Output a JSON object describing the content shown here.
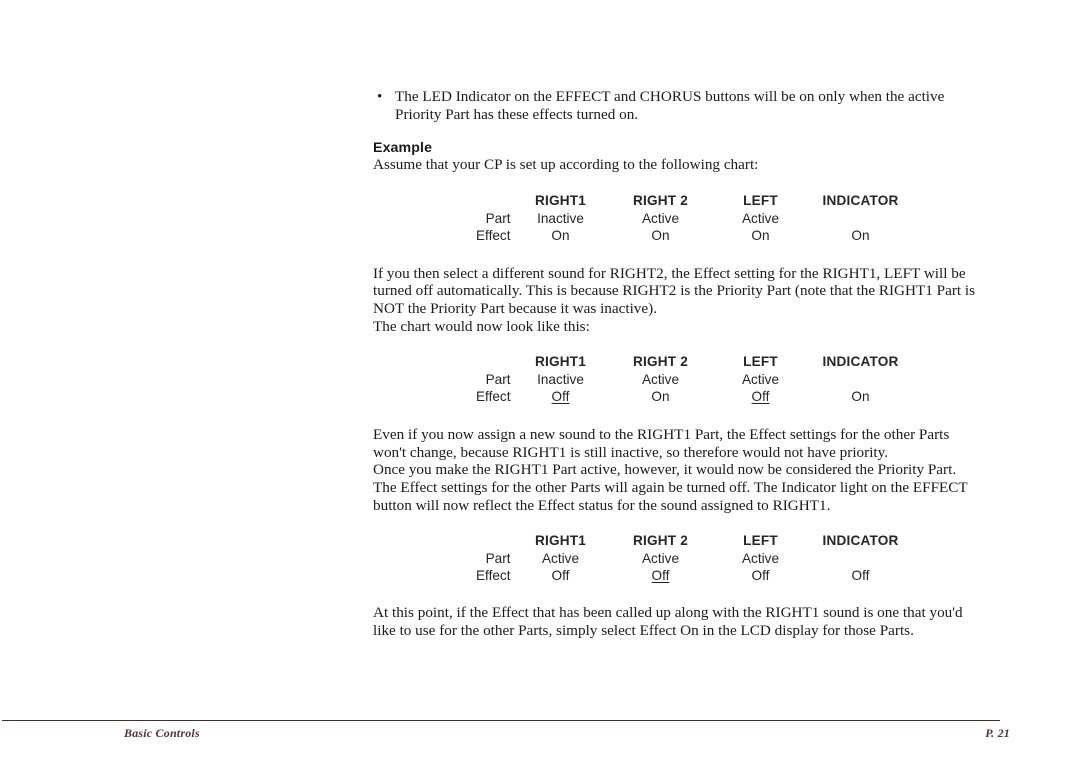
{
  "page": {
    "bullet_marker": "•",
    "bullet_note_lines": [
      "The LED Indicator on the EFFECT and CHORUS buttons will be on only when the active Priority",
      "Part has these effects turned on."
    ],
    "example_heading": "Example",
    "intro_line": "Assume that your CP is set up according to the following chart:",
    "paragraph_2_lines": [
      "If you then select a different sound for RIGHT2, the Effect setting for the RIGHT1, LEFT will be",
      "turned off automatically.  This is because RIGHT2 is the Priority Part (note that the RIGHT1 Part is",
      "NOT the Priority Part because it was inactive).",
      "The chart would now look like this:"
    ],
    "paragraph_3_lines": [
      "Even if you now assign a new sound to the RIGHT1 Part, the Effect settings for the other Parts",
      "won't change, because RIGHT1 is still inactive, so therefore would not have priority.",
      "Once you make the RIGHT1 Part active, however, it would now be considered the Priority Part.",
      "The Effect settings for the other Parts will again be turned off.  The Indicator light on the EFFECT",
      "button will now reflect the Effect status for the sound assigned to RIGHT1."
    ],
    "paragraph_4_lines": [
      "At this point, if the Effect that has been called up along with the RIGHT1 sound is one that you'd",
      "like to use for the other Parts, simply select Effect On in the LCD display for those Parts."
    ]
  },
  "chart_data": [
    {
      "type": "table",
      "title": "",
      "columns": [
        "RIGHT1",
        "RIGHT 2",
        "LEFT",
        "INDICATOR"
      ],
      "row_labels": [
        "Part",
        "Effect"
      ],
      "rows": [
        [
          "Inactive",
          "Active",
          "Active",
          ""
        ],
        [
          "On",
          "On",
          "On",
          "On"
        ]
      ],
      "underlined": []
    },
    {
      "type": "table",
      "title": "",
      "columns": [
        "RIGHT1",
        "RIGHT 2",
        "LEFT",
        "INDICATOR"
      ],
      "row_labels": [
        "Part",
        "Effect"
      ],
      "rows": [
        [
          "Inactive",
          "Active",
          "Active",
          ""
        ],
        [
          "Off",
          "On",
          "Off",
          "On"
        ]
      ],
      "underlined": [
        [
          1,
          0
        ],
        [
          1,
          2
        ]
      ]
    },
    {
      "type": "table",
      "title": "",
      "columns": [
        "RIGHT1",
        "RIGHT 2",
        "LEFT",
        "INDICATOR"
      ],
      "row_labels": [
        "Part",
        "Effect"
      ],
      "rows": [
        [
          "Active",
          "Active",
          "Active",
          ""
        ],
        [
          "Off",
          "Off",
          "Off",
          "Off"
        ]
      ],
      "underlined": [
        [
          1,
          1
        ]
      ]
    }
  ],
  "footer": {
    "section": "Basic Controls",
    "page_number": "P. 21"
  }
}
